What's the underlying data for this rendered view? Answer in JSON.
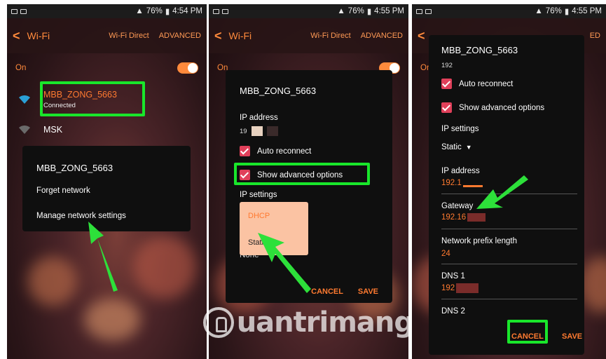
{
  "screens": [
    {
      "status": {
        "battery": "76%",
        "time": "4:54 PM"
      },
      "appbar": {
        "title": "Wi-Fi",
        "wifi_direct": "Wi-Fi Direct",
        "advanced": "ADVANCED"
      },
      "wifi_switch": {
        "label": "On",
        "state": "on"
      },
      "networks": [
        {
          "name": "MBB_ZONG_5663",
          "status": "Connected"
        },
        {
          "name": "MSK"
        }
      ],
      "menu": {
        "title": "MBB_ZONG_5663",
        "items": [
          "Forget network",
          "Manage network settings"
        ]
      }
    },
    {
      "status": {
        "battery": "76%",
        "time": "4:55 PM"
      },
      "appbar": {
        "title": "Wi-Fi",
        "wifi_direct": "Wi-Fi Direct",
        "advanced": "ADVANCED"
      },
      "wifi_switch": {
        "label": "On",
        "state": "on"
      },
      "dialog": {
        "title": "MBB_ZONG_5663",
        "ip_label": "IP address",
        "ip_value": "19",
        "auto_reconnect": "Auto reconnect",
        "show_advanced": "Show advanced options",
        "ip_settings": "IP settings",
        "ip_settings_value": "None",
        "options": [
          "DHCP",
          "Static"
        ],
        "cancel": "CANCEL",
        "save": "SAVE"
      }
    },
    {
      "status": {
        "battery": "76%",
        "time": "4:55 PM"
      },
      "appbar": {
        "advanced": "ED"
      },
      "wifi_switch": {
        "label": "On"
      },
      "dialog": {
        "title": "MBB_ZONG_5663",
        "ip_short": "192",
        "auto_reconnect": "Auto reconnect",
        "show_advanced": "Show advanced options",
        "ip_settings": "IP settings",
        "ip_settings_value": "Static",
        "ip_label": "IP address",
        "ip_value": "192.1",
        "gateway_label": "Gateway",
        "gateway_value": "192.16",
        "prefix_label": "Network prefix length",
        "prefix_value": "24",
        "dns1_label": "DNS 1",
        "dns1_value": "192",
        "dns2_label": "DNS 2",
        "cancel": "CANCEL",
        "save": "SAVE"
      }
    }
  ],
  "watermark": {
    "text": "uantrimang"
  },
  "colors": {
    "accent": "#ff7a30",
    "highlight": "#19e62b",
    "checkbox": "#e0405a",
    "dropdown_bg": "#fbc3a3"
  }
}
